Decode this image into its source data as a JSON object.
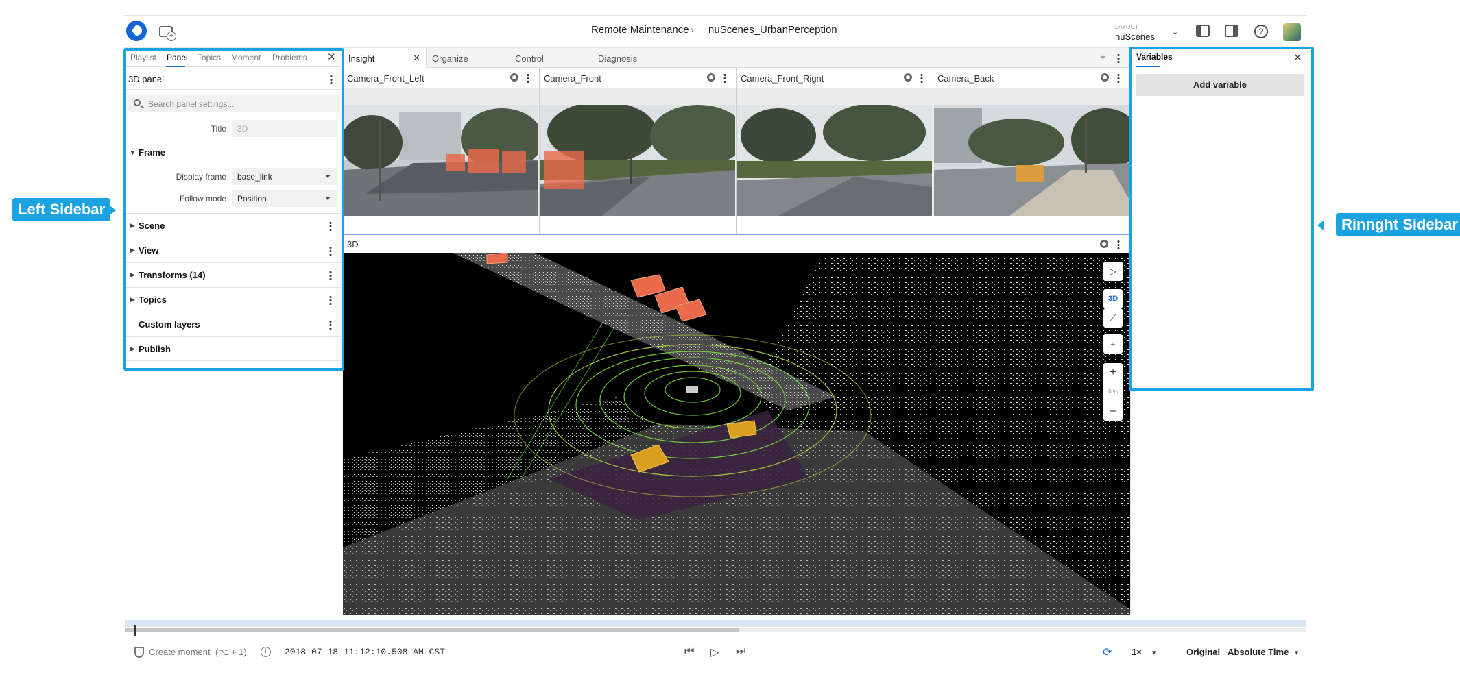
{
  "header": {
    "breadcrumb_parent": "Remote Maintenance",
    "breadcrumb_separator": "›",
    "breadcrumb_current": "nuScenes_UrbanPerception",
    "layout_label": "LAYOUT",
    "layout_value": "nuScenes",
    "help_glyph": "?"
  },
  "left_sidebar": {
    "tabs": [
      "Playlist",
      "Panel",
      "Topics",
      "Moment",
      "Problems"
    ],
    "active_tab": "Panel",
    "panel_name": "3D panel",
    "search_placeholder": "Search panel settings...",
    "fields": {
      "title_label": "Title",
      "title_placeholder": "3D",
      "frame_section": "Frame",
      "display_frame_label": "Display frame",
      "display_frame_value": "base_link",
      "follow_mode_label": "Follow mode",
      "follow_mode_value": "Position"
    },
    "sections": [
      "Scene",
      "View",
      "Transforms (14)",
      "Topics",
      "Custom layers",
      "Publish"
    ]
  },
  "main": {
    "tabs": [
      "Insight",
      "Organize",
      "Control",
      "Diagnosis"
    ],
    "active_tab": "Insight",
    "cameras": [
      "Camera_Front_Left",
      "Camera_Front",
      "Camera_Front_Rignt",
      "Camera_Back"
    ],
    "panel_3d_title": "3D",
    "view_mode": "3D",
    "zoom_percent": "0 %",
    "zoom_in": "+",
    "zoom_out": "–",
    "add_tab": "+"
  },
  "right_sidebar": {
    "title": "Variables",
    "add_button": "Add variable"
  },
  "annotations": {
    "left": "Left Sidebar",
    "right": "Rinnght Sidebar"
  },
  "footer": {
    "create_moment": "Create moment",
    "create_moment_shortcut": "(⌥ + 1)",
    "timestamp": "2018-07-18 11:12:10.508 AM CST",
    "speed": "1×",
    "mode": "Original",
    "time_format": "Absolute Time",
    "playback_progress": 0.52
  },
  "colors": {
    "accent": "#1e6fd9",
    "callout": "#1aa3e0",
    "bounding_box_orange": "#e86a4a",
    "bounding_box_yellow": "#e6b030",
    "lidar_green": "#7cdc3c"
  }
}
